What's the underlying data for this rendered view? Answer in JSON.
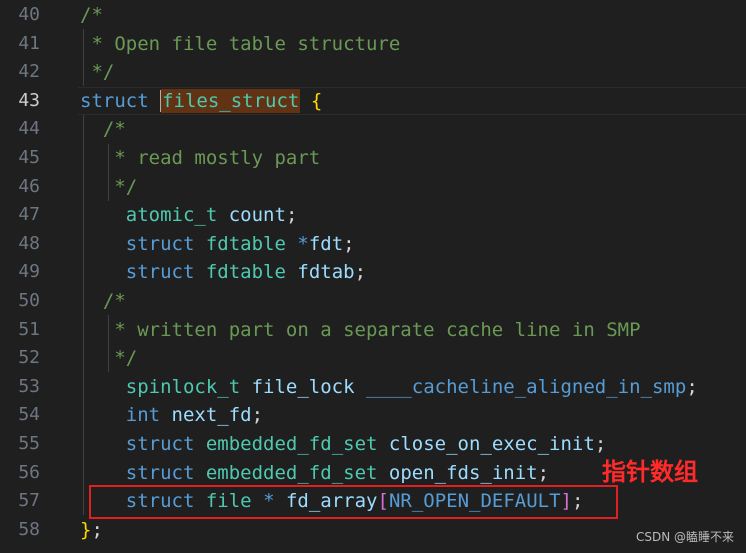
{
  "editor": {
    "current_line": "43",
    "lines": [
      {
        "num": "40",
        "parts": [
          {
            "t": "/*",
            "c": "cm"
          }
        ]
      },
      {
        "num": "41",
        "parts": [
          {
            "t": " * Open file table structure",
            "c": "cm"
          }
        ]
      },
      {
        "num": "42",
        "parts": [
          {
            "t": " */",
            "c": "cm"
          }
        ]
      },
      {
        "num": "43",
        "parts": [
          {
            "t": "struct",
            "c": "kw"
          },
          {
            "t": " "
          },
          {
            "t": "files_struct",
            "c": "type",
            "hl": true
          },
          {
            "t": " "
          },
          {
            "t": "{",
            "c": "brace"
          }
        ]
      },
      {
        "num": "44",
        "parts": [
          {
            "t": "  /*",
            "c": "cm"
          }
        ]
      },
      {
        "num": "45",
        "parts": [
          {
            "t": "   * read mostly part",
            "c": "cm"
          }
        ]
      },
      {
        "num": "46",
        "parts": [
          {
            "t": "   */",
            "c": "cm"
          }
        ]
      },
      {
        "num": "47",
        "parts": [
          {
            "t": "    "
          },
          {
            "t": "atomic_t",
            "c": "type"
          },
          {
            "t": " "
          },
          {
            "t": "count",
            "c": "var"
          },
          {
            "t": ";"
          }
        ]
      },
      {
        "num": "48",
        "parts": [
          {
            "t": "    "
          },
          {
            "t": "struct",
            "c": "kw"
          },
          {
            "t": " "
          },
          {
            "t": "fdtable",
            "c": "type"
          },
          {
            "t": " "
          },
          {
            "t": "*",
            "c": "kw"
          },
          {
            "t": "fdt",
            "c": "var"
          },
          {
            "t": ";"
          }
        ]
      },
      {
        "num": "49",
        "parts": [
          {
            "t": "    "
          },
          {
            "t": "struct",
            "c": "kw"
          },
          {
            "t": " "
          },
          {
            "t": "fdtable",
            "c": "type"
          },
          {
            "t": " "
          },
          {
            "t": "fdtab",
            "c": "var"
          },
          {
            "t": ";"
          }
        ]
      },
      {
        "num": "50",
        "parts": [
          {
            "t": "  /*",
            "c": "cm"
          }
        ]
      },
      {
        "num": "51",
        "parts": [
          {
            "t": "   * written part on a separate cache line in SMP",
            "c": "cm"
          }
        ]
      },
      {
        "num": "52",
        "parts": [
          {
            "t": "   */",
            "c": "cm"
          }
        ]
      },
      {
        "num": "53",
        "parts": [
          {
            "t": "    "
          },
          {
            "t": "spinlock_t",
            "c": "type"
          },
          {
            "t": " "
          },
          {
            "t": "file_lock",
            "c": "var"
          },
          {
            "t": " "
          },
          {
            "t": "____cacheline_aligned_in_smp",
            "c": "kw"
          },
          {
            "t": ";"
          }
        ]
      },
      {
        "num": "54",
        "parts": [
          {
            "t": "    "
          },
          {
            "t": "int",
            "c": "kw"
          },
          {
            "t": " "
          },
          {
            "t": "next_fd",
            "c": "var"
          },
          {
            "t": ";"
          }
        ]
      },
      {
        "num": "55",
        "parts": [
          {
            "t": "    "
          },
          {
            "t": "struct",
            "c": "kw"
          },
          {
            "t": " "
          },
          {
            "t": "embedded_fd_set",
            "c": "type"
          },
          {
            "t": " "
          },
          {
            "t": "close_on_exec_init",
            "c": "var"
          },
          {
            "t": ";"
          }
        ]
      },
      {
        "num": "56",
        "parts": [
          {
            "t": "    "
          },
          {
            "t": "struct",
            "c": "kw"
          },
          {
            "t": " "
          },
          {
            "t": "embedded_fd_set",
            "c": "type"
          },
          {
            "t": " "
          },
          {
            "t": "open_fds_init",
            "c": "var"
          },
          {
            "t": ";"
          }
        ]
      },
      {
        "num": "57",
        "parts": [
          {
            "t": "    "
          },
          {
            "t": "struct",
            "c": "kw"
          },
          {
            "t": " "
          },
          {
            "t": "file",
            "c": "type"
          },
          {
            "t": " "
          },
          {
            "t": "*",
            "c": "kw"
          },
          {
            "t": " "
          },
          {
            "t": "fd_array",
            "c": "var"
          },
          {
            "t": "[",
            "c": "bracket-purple"
          },
          {
            "t": "NR_OPEN_DEFAULT",
            "c": "macro"
          },
          {
            "t": "]",
            "c": "bracket-purple"
          },
          {
            "t": ";"
          }
        ]
      },
      {
        "num": "58",
        "parts": [
          {
            "t": "}",
            "c": "brace"
          },
          {
            "t": ";"
          }
        ]
      }
    ]
  },
  "annotation": {
    "text": "指针数组"
  },
  "watermark": {
    "text": "CSDN @瞌睡不来"
  },
  "colors": {
    "background": "#1f1f1f",
    "keyword": "#569cd6",
    "type": "#4ec9b0",
    "variable": "#9cdcfe",
    "comment": "#6a9955",
    "brace": "#ffd700",
    "annotation": "#ff2a2a"
  }
}
